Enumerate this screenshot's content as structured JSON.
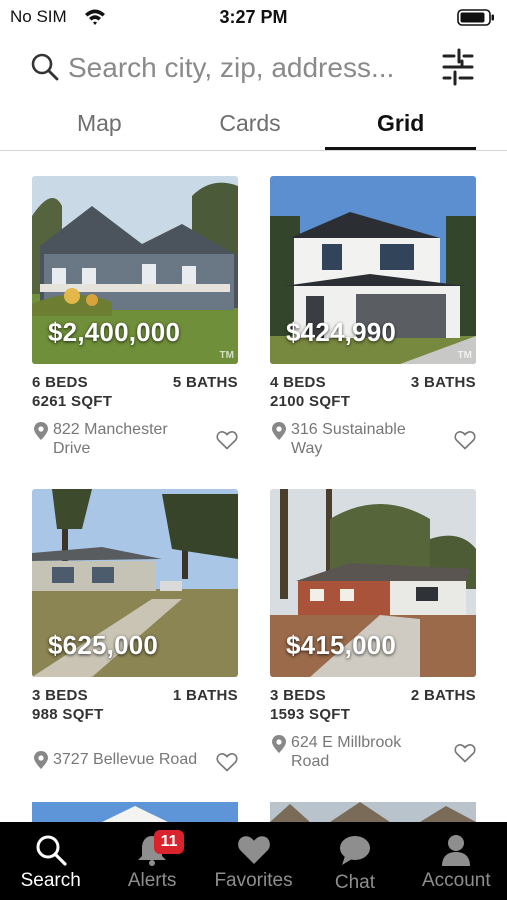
{
  "status_bar": {
    "carrier": "No SIM",
    "time": "3:27 PM"
  },
  "search": {
    "placeholder": "Search city, zip, address..."
  },
  "view_tabs": [
    {
      "label": "Map",
      "active": false
    },
    {
      "label": "Cards",
      "active": false
    },
    {
      "label": "Grid",
      "active": true
    }
  ],
  "listings": [
    {
      "price": "$2,400,000",
      "beds": "6 BEDS",
      "baths": "5 BATHS",
      "sqft": "6261 SQFT",
      "address": "822 Manchester Drive",
      "watermark": "TM"
    },
    {
      "price": "$424,990",
      "beds": "4 BEDS",
      "baths": "3 BATHS",
      "sqft": "2100 SQFT",
      "address": "316 Sustainable Way",
      "watermark": "TM"
    },
    {
      "price": "$625,000",
      "beds": "3 BEDS",
      "baths": "1 BATHS",
      "sqft": "988 SQFT",
      "address": "3727 Bellevue Road"
    },
    {
      "price": "$415,000",
      "beds": "3 BEDS",
      "baths": "2 BATHS",
      "sqft": "1593 SQFT",
      "address": "624 E Millbrook Road"
    }
  ],
  "tab_bar": {
    "items": [
      {
        "label": "Search",
        "icon": "search-icon",
        "active": true
      },
      {
        "label": "Alerts",
        "icon": "bell-icon",
        "badge": "11"
      },
      {
        "label": "Favorites",
        "icon": "heart-icon"
      },
      {
        "label": "Chat",
        "icon": "chat-bubble-icon"
      },
      {
        "label": "Account",
        "icon": "person-icon"
      }
    ]
  },
  "colors": {
    "active_tab_underline": "#111111",
    "badge": "#d9232d",
    "tab_bar_bg": "#000000"
  }
}
